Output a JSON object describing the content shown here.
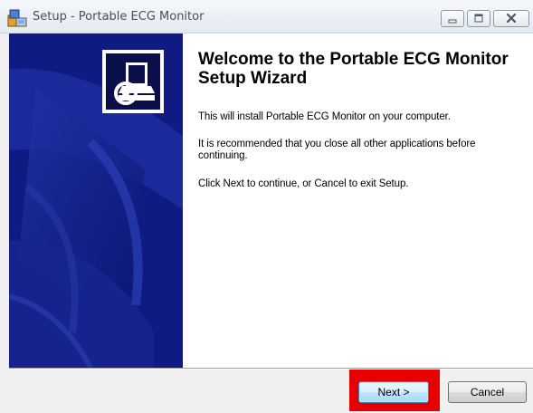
{
  "window": {
    "title": "Setup - Portable ECG Monitor",
    "icons": {
      "app": "setup-installer-icon",
      "minimize": "minimize-icon",
      "maximize": "maximize-icon",
      "close": "close-icon"
    }
  },
  "wizard": {
    "heading": "Welcome to the Portable ECG Monitor Setup Wizard",
    "paragraphs": [
      "This will install Portable ECG Monitor on your computer.",
      "It is recommended that you close all other applications before continuing.",
      "Click Next to continue, or Cancel to exit Setup."
    ],
    "logo_icon": "computer-install-icon"
  },
  "buttons": {
    "next": "Next >",
    "cancel": "Cancel"
  },
  "colors": {
    "banner": "#0f1b82",
    "highlight": "#e60000",
    "next_border": "#3c7fb1"
  }
}
